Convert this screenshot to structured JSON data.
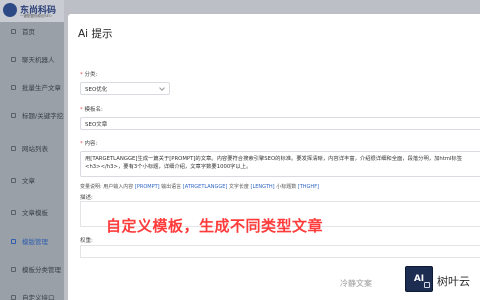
{
  "sidebar": {
    "logo_title": "东尚科码",
    "logo_sub": "一键配置伪原创SEO",
    "items": [
      {
        "label": "首页",
        "icon": "home-icon"
      },
      {
        "label": "聊天机器人",
        "icon": "chat-icon"
      },
      {
        "label": "批量生产文章",
        "icon": "document-icon"
      },
      {
        "label": "标题/关键字挖掘",
        "icon": "keyword-icon"
      },
      {
        "label": "网站列表",
        "icon": "site-icon"
      },
      {
        "label": "文章",
        "icon": "article-icon"
      },
      {
        "label": "文章模板",
        "icon": "template-icon"
      },
      {
        "label": "模版管理",
        "icon": "template-manage-icon"
      },
      {
        "label": "模板分类管理",
        "icon": "category-icon"
      },
      {
        "label": "自定义接口",
        "icon": "api-icon"
      }
    ],
    "active_index": 7
  },
  "modal": {
    "title": "Ai 提示",
    "category_label": "分类:",
    "category_value": "SEO优化",
    "template_name_label": "模板名:",
    "template_name_value": "SEO文章",
    "content_label": "内容:",
    "content_value": "用[TARGETLANGGE]生成一篇关于[PROMPT]的文章。内容要符合搜索引擎SEO的标准。要发挥清晰，内容详丰富，介绍很详细和全面，段落分明，加html标签<h3></h3>，要有3个小标题，详细介绍，文章字数要1000字以上。",
    "hint_prefix": "变量说明: 用户输入内容",
    "hint_var1": "[PROMPT]",
    "hint_mid1": " 输出语言",
    "hint_var2": "[ATRGETLANGGE]",
    "hint_mid2": " 文字长度",
    "hint_var3": "[LENGTH]",
    "hint_mid3": " 小标题数",
    "hint_var4": "[THGHF]",
    "desc_label": "描述:",
    "sort_label": "权重:"
  },
  "banner": "自定义模板，生成不同类型文章",
  "watermark": {
    "text": "冷静文案",
    "logo_text": "AI",
    "brand": "树叶云"
  },
  "colors": {
    "accent": "#2f5fae",
    "banner": "#ff3b3b",
    "required": "#e34d4d"
  }
}
